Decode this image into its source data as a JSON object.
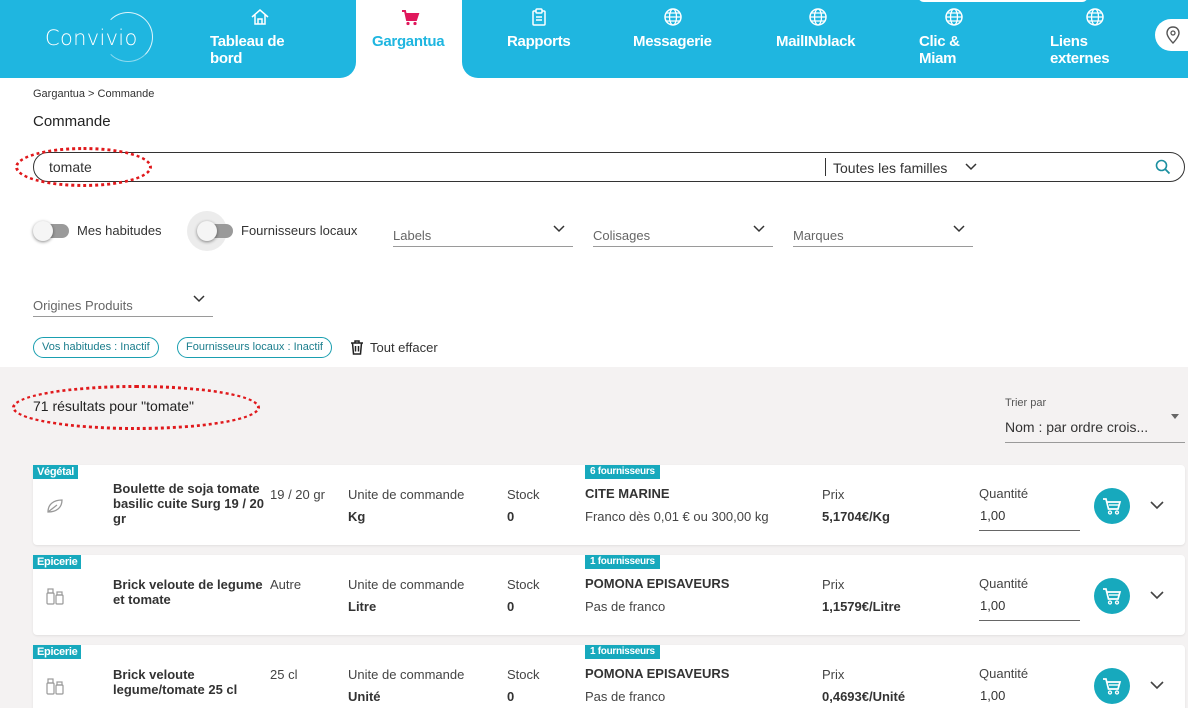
{
  "app": {
    "logo_text": "Convivio"
  },
  "nav": [
    {
      "label": "Tableau de\nbord",
      "icon": "home-icon"
    },
    {
      "label": "Gargantua",
      "icon": "cart-icon",
      "active": true
    },
    {
      "label": "Rapports",
      "icon": "clipboard-icon"
    },
    {
      "label": "Messagerie",
      "icon": "globe-icon"
    },
    {
      "label": "MailINblack",
      "icon": "globe-icon"
    },
    {
      "label": "Clic &\nMiam",
      "icon": "globe-icon"
    },
    {
      "label": "Liens\nexternes",
      "icon": "globe-icon"
    }
  ],
  "breadcrumb": "Gargantua > Commande",
  "page_title": "Commande",
  "search": {
    "query": "tomate",
    "family_filter": "Toutes les familles"
  },
  "filters": {
    "toggle_habitudes": "Mes habitudes",
    "toggle_fournisseurs": "Fournisseurs locaux",
    "labels": "Labels",
    "colisages": "Colisages",
    "marques": "Marques",
    "origines": "Origines Produits"
  },
  "chips": [
    "Vos habitudes : Inactif",
    "Fournisseurs locaux : Inactif"
  ],
  "clear_all": "Tout effacer",
  "results": {
    "count_text": "71 résultats pour \"tomate\"",
    "sort_label": "Trier par",
    "sort_value": "Nom : par ordre crois..."
  },
  "product_labels": {
    "unit": "Unite de commande",
    "stock": "Stock",
    "price": "Prix",
    "quantity": "Quantité"
  },
  "products": [
    {
      "category": "Végétal",
      "icon": "leaf-icon",
      "name": "Boulette de soja tomate basilic cuite Surg 19 / 20 gr",
      "conditioning": "19 / 20 gr",
      "unit": "Kg",
      "stock": "0",
      "suppliers_badge": "6 fournisseurs",
      "supplier": "CITE MARINE",
      "franco": "Franco dès 0,01 € ou 300,00 kg",
      "price": "5,1704€/Kg",
      "quantity": "1,00"
    },
    {
      "category": "Epicerie",
      "icon": "jars-icon",
      "name": "Brick veloute de legume et tomate",
      "conditioning": "Autre",
      "unit": "Litre",
      "stock": "0",
      "suppliers_badge": "1 fournisseurs",
      "supplier": "POMONA EPISAVEURS",
      "franco": "Pas de franco",
      "price": "1,1579€/Litre",
      "quantity": "1,00"
    },
    {
      "category": "Epicerie",
      "icon": "jars-icon",
      "name": "Brick veloute legume/tomate 25 cl",
      "conditioning": "25 cl",
      "unit": "Unité",
      "stock": "0",
      "suppliers_badge": "1 fournisseurs",
      "supplier": "POMONA EPISAVEURS",
      "franco": "Pas de franco",
      "price": "0,4693€/Unité",
      "quantity": "1,00"
    }
  ],
  "colors": {
    "nav_bg": "#1fb6e0",
    "active_icon": "#e0185c",
    "accent": "#17a9bd",
    "annotation": "#e0191c"
  }
}
